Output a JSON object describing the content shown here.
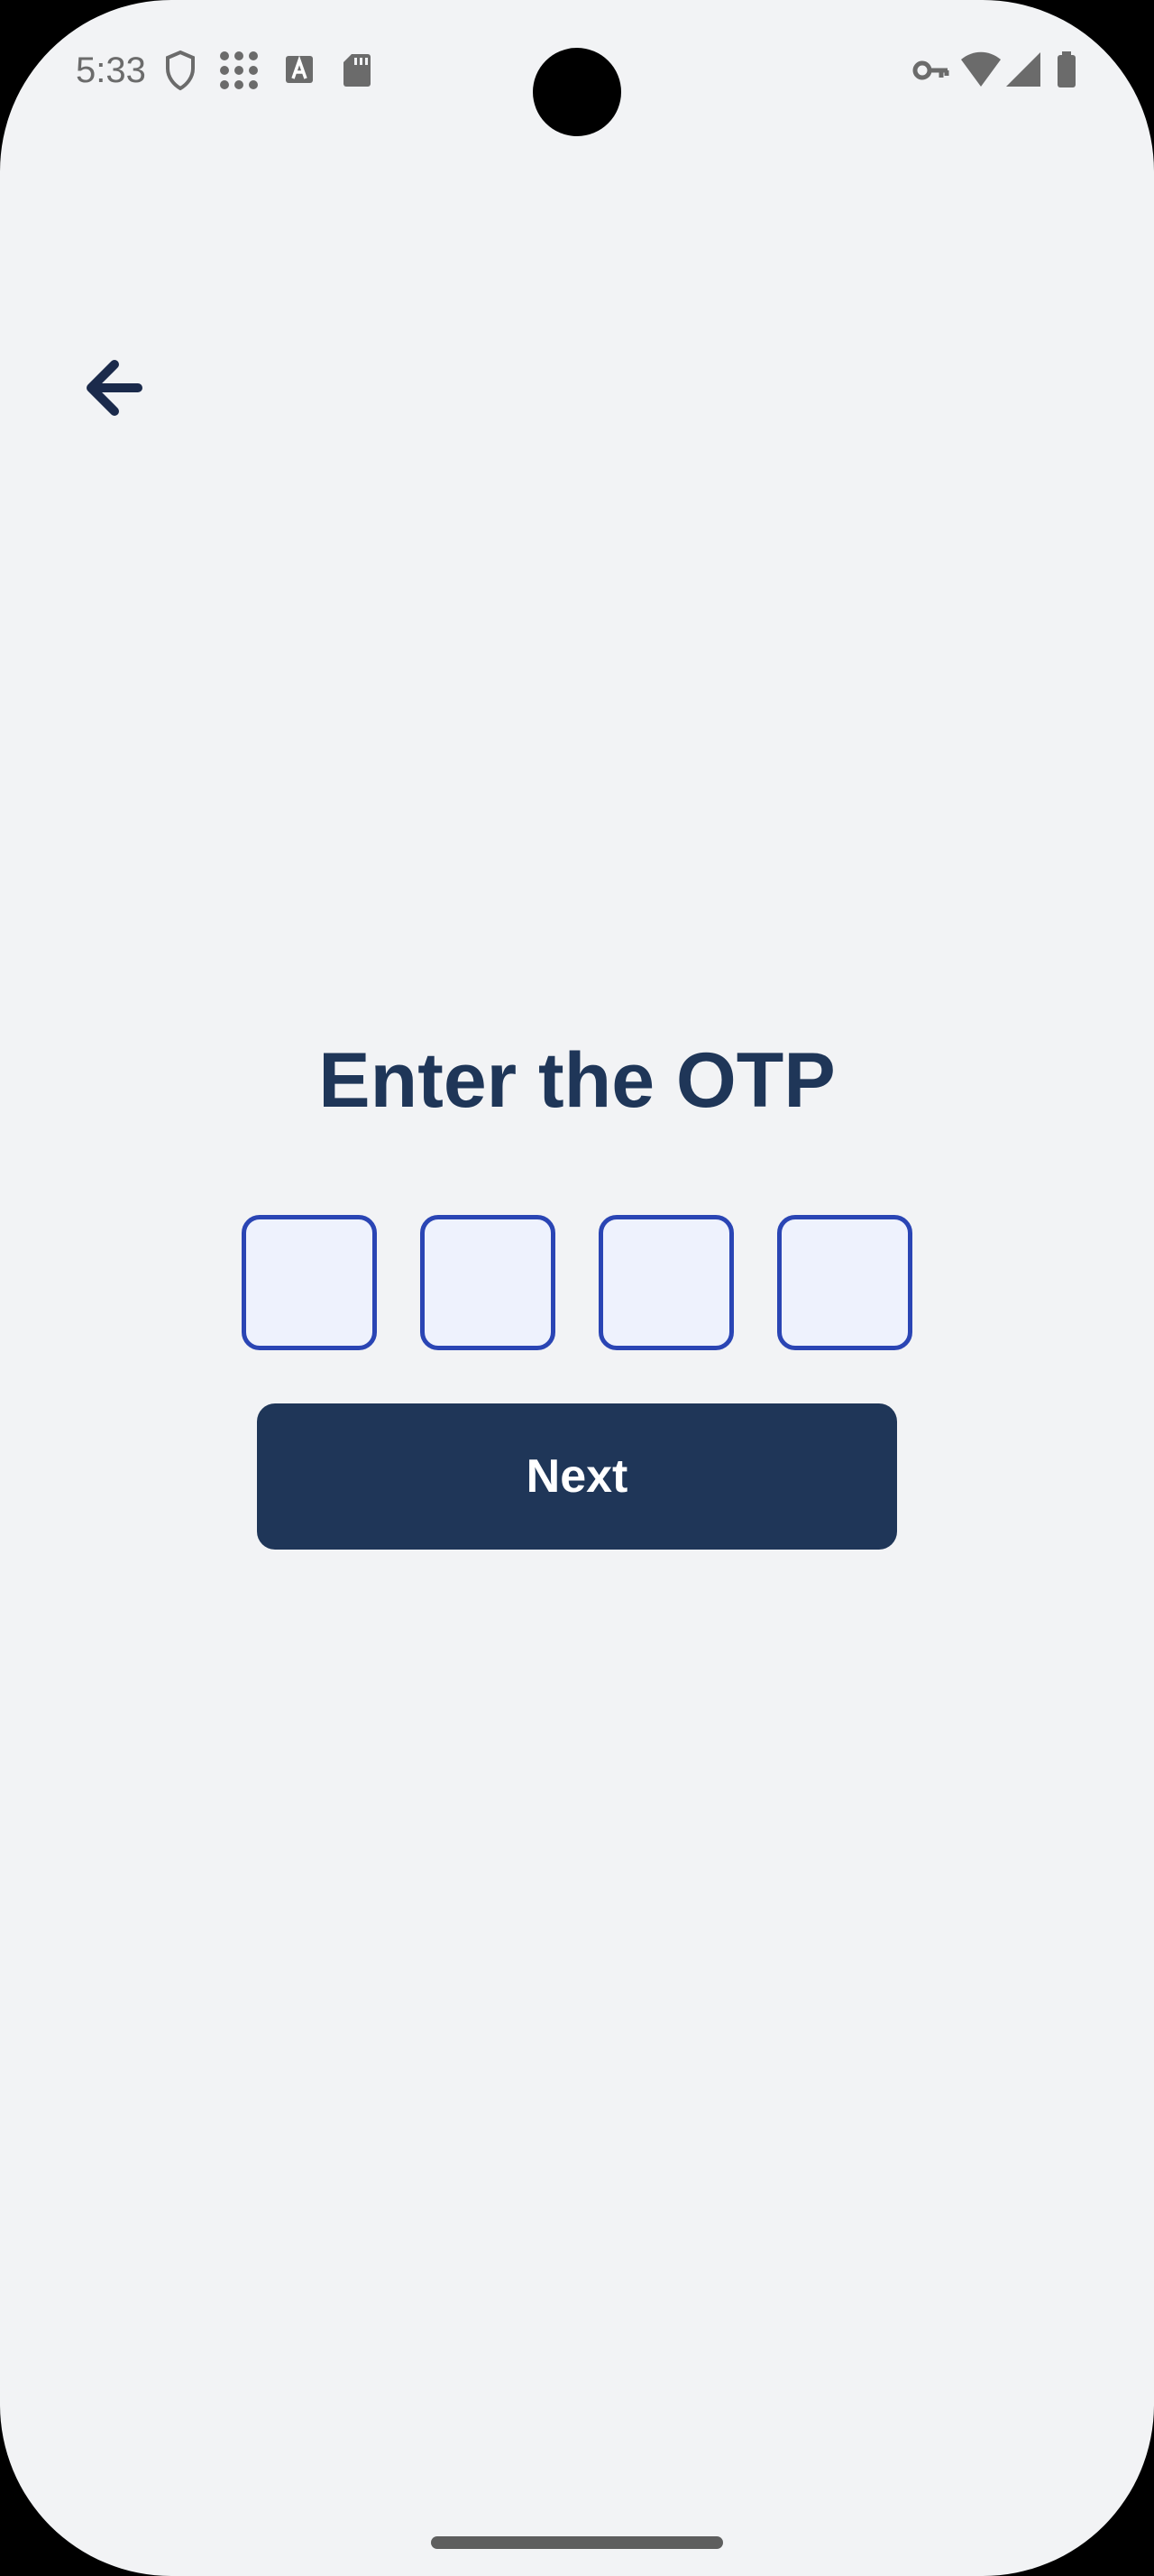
{
  "status_bar": {
    "time": "5:33",
    "icons_left": [
      "shield-icon",
      "dots-grid-icon",
      "text-a-icon",
      "sd-card-icon"
    ],
    "icons_right": [
      "key-icon",
      "wifi-icon",
      "signal-icon",
      "battery-icon"
    ]
  },
  "header": {
    "back_icon": "arrow-left-icon"
  },
  "otp": {
    "title": "Enter the OTP",
    "digits": [
      "",
      "",
      "",
      ""
    ]
  },
  "actions": {
    "next_label": "Next"
  },
  "colors": {
    "background": "#f2f3f5",
    "primary": "#1f3658",
    "otp_border": "#2a45b4",
    "otp_fill": "#eef2fd",
    "button_text": "#ffffff"
  }
}
